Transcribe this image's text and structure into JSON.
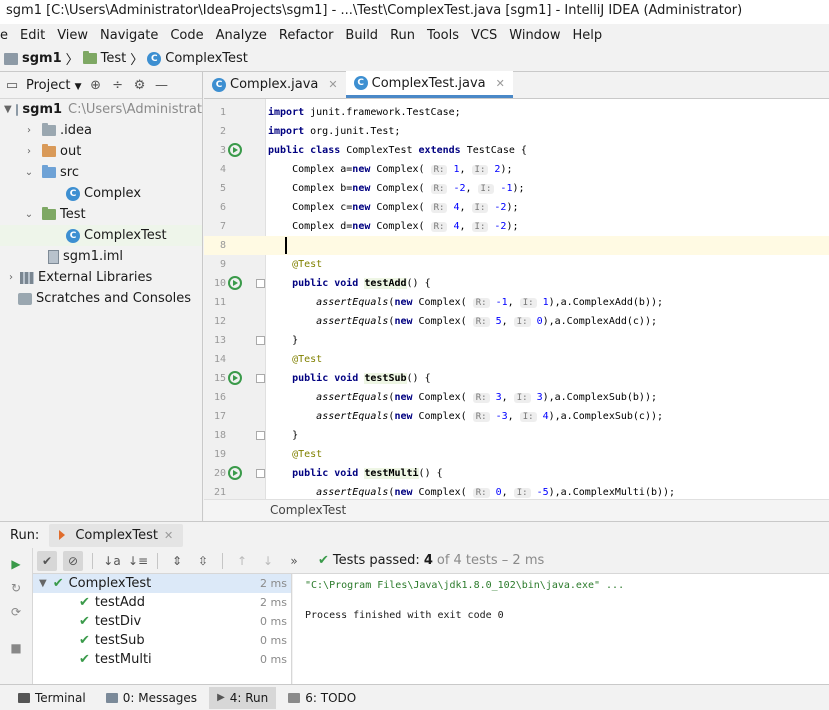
{
  "window": {
    "title": "sgm1 [C:\\Users\\Administrator\\IdeaProjects\\sgm1] - ...\\Test\\ComplexTest.java [sgm1] - IntelliJ IDEA (Administrator)"
  },
  "menu": [
    "e",
    "Edit",
    "View",
    "Navigate",
    "Code",
    "Analyze",
    "Refactor",
    "Build",
    "Run",
    "Tools",
    "VCS",
    "Window",
    "Help"
  ],
  "navbar": {
    "project": "sgm1",
    "folder": "Test",
    "file": "ComplexTest"
  },
  "project_panel": {
    "title": "Project",
    "tree": [
      {
        "label": "sgm1",
        "path": "C:\\Users\\Administrat"
      },
      {
        "label": ".idea"
      },
      {
        "label": "out"
      },
      {
        "label": "src"
      },
      {
        "label": "Complex"
      },
      {
        "label": "Test"
      },
      {
        "label": "ComplexTest"
      },
      {
        "label": "sgm1.iml"
      },
      {
        "label": "External Libraries"
      },
      {
        "label": "Scratches and Consoles"
      }
    ]
  },
  "editor": {
    "tabs": [
      {
        "label": "Complex.java"
      },
      {
        "label": "ComplexTest.java"
      }
    ],
    "line_numbers": [
      "1",
      "2",
      "3",
      "4",
      "5",
      "6",
      "7",
      "8",
      "9",
      "10",
      "11",
      "12",
      "13",
      "14",
      "15",
      "16",
      "17",
      "18",
      "19",
      "20",
      "21"
    ],
    "breadcrumb": "ComplexTest"
  },
  "run_panel": {
    "label": "Run:",
    "tab": "ComplexTest",
    "status": {
      "prefix": "Tests passed:",
      "passed": "4",
      "suffix": "of 4 tests – 2 ms"
    },
    "tests": [
      {
        "name": "ComplexTest",
        "time": "2 ms"
      },
      {
        "name": "testAdd",
        "time": "2 ms"
      },
      {
        "name": "testDiv",
        "time": "0 ms"
      },
      {
        "name": "testSub",
        "time": "0 ms"
      },
      {
        "name": "testMulti",
        "time": "0 ms"
      }
    ],
    "console": [
      "\"C:\\Program Files\\Java\\jdk1.8.0_102\\bin\\java.exe\" ...",
      "Process finished with exit code 0"
    ]
  },
  "bottom_bar": [
    {
      "label": "Terminal"
    },
    {
      "label": "0: Messages"
    },
    {
      "label": "4: Run"
    },
    {
      "label": "6: TODO"
    }
  ]
}
